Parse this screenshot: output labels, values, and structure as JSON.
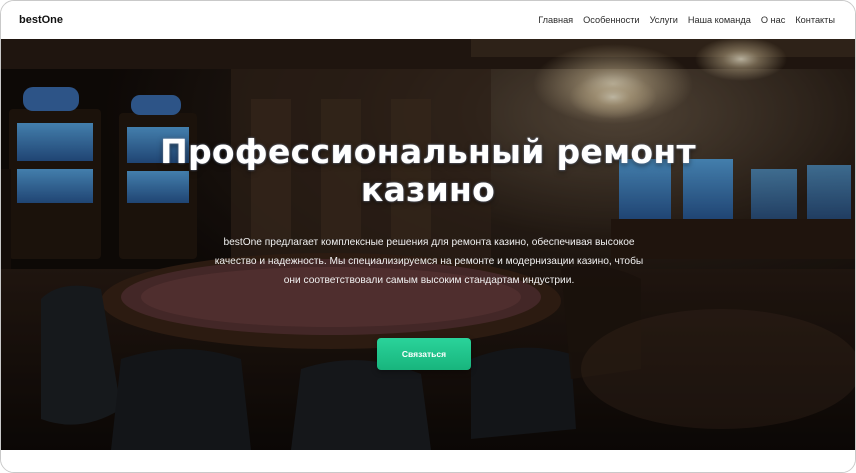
{
  "navbar": {
    "brand": "bestOne",
    "links": [
      "Главная",
      "Особенности",
      "Услуги",
      "Наша команда",
      "О нас",
      "Контакты"
    ]
  },
  "hero": {
    "title": "Профессиональный ремонт казино",
    "description": "bestOne предлагает комплексные решения для ремонта казино, обеспечивая высокое качество и надежность. Мы специализируемся на ремонте и модернизации казино, чтобы они соответствовали самым высоким стандартам индустрии.",
    "cta_label": "Связаться"
  },
  "colors": {
    "accent": "#1fc98c",
    "navbar_bg": "#ffffff",
    "hero_text": "#ffffff"
  }
}
